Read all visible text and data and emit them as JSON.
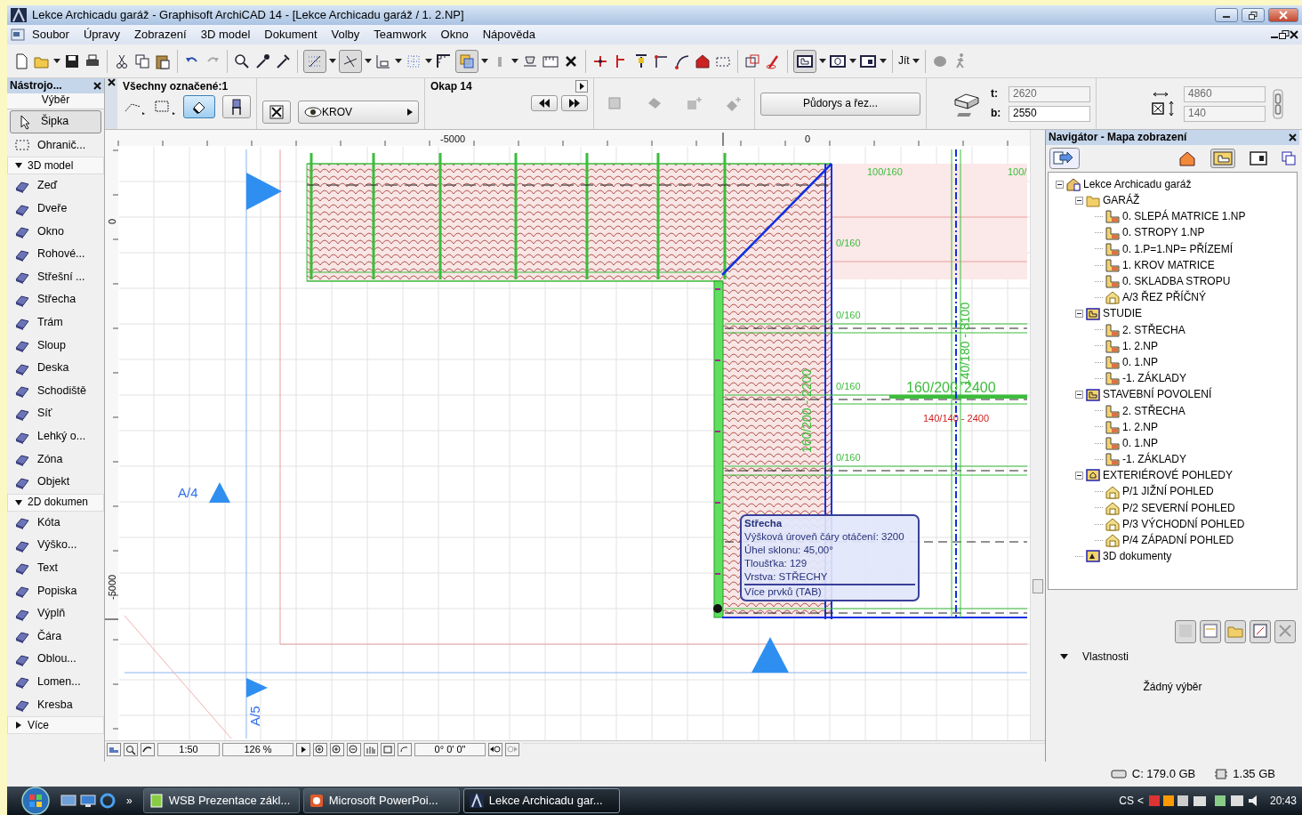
{
  "window": {
    "title": "Lekce Archicadu garáž - Graphisoft ArchiCAD 14 - [Lekce Archicadu garáž / 1. 2.NP]"
  },
  "menu": [
    "Soubor",
    "Úpravy",
    "Zobrazení",
    "3D model",
    "Dokument",
    "Volby",
    "Teamwork",
    "Okno",
    "Nápověda"
  ],
  "toolbar": {
    "go_label": "Jít"
  },
  "toolbox": {
    "title": "Nástrojo...",
    "selection": "Výběr",
    "items": [
      {
        "kind": "tool",
        "label": "Šipka",
        "selected": true
      },
      {
        "kind": "tool",
        "label": "Ohranič...",
        "selected": false
      },
      {
        "kind": "group",
        "label": "3D model",
        "expanded": true
      },
      {
        "kind": "tool",
        "label": "Zeď",
        "selected": false
      },
      {
        "kind": "tool",
        "label": "Dveře",
        "selected": false
      },
      {
        "kind": "tool",
        "label": "Okno",
        "selected": false
      },
      {
        "kind": "tool",
        "label": "Rohové...",
        "selected": false
      },
      {
        "kind": "tool",
        "label": "Střešní ...",
        "selected": false
      },
      {
        "kind": "tool",
        "label": "Střecha",
        "selected": false
      },
      {
        "kind": "tool",
        "label": "Trám",
        "selected": false
      },
      {
        "kind": "tool",
        "label": "Sloup",
        "selected": false
      },
      {
        "kind": "tool",
        "label": "Deska",
        "selected": false
      },
      {
        "kind": "tool",
        "label": "Schodiště",
        "selected": false
      },
      {
        "kind": "tool",
        "label": "Síť",
        "selected": false
      },
      {
        "kind": "tool",
        "label": "Lehký o...",
        "selected": false
      },
      {
        "kind": "tool",
        "label": "Zóna",
        "selected": false
      },
      {
        "kind": "tool",
        "label": "Objekt",
        "selected": false
      },
      {
        "kind": "group",
        "label": "2D dokumen",
        "expanded": true
      },
      {
        "kind": "tool",
        "label": "Kóta",
        "selected": false
      },
      {
        "kind": "tool",
        "label": "Výško...",
        "selected": false
      },
      {
        "kind": "tool",
        "label": "Text",
        "selected": false
      },
      {
        "kind": "tool",
        "label": "Popiska",
        "selected": false
      },
      {
        "kind": "tool",
        "label": "Výplň",
        "selected": false
      },
      {
        "kind": "tool",
        "label": "Čára",
        "selected": false
      },
      {
        "kind": "tool",
        "label": "Oblou...",
        "selected": false
      },
      {
        "kind": "tool",
        "label": "Lomen...",
        "selected": false
      },
      {
        "kind": "tool",
        "label": "Kresba",
        "selected": false
      },
      {
        "kind": "group",
        "label": "Více",
        "expanded": false
      }
    ]
  },
  "info_box": {
    "selection": "Všechny označené:1",
    "layer": "KROV",
    "story": "Okap 14",
    "view_button": "Půdorys a řez...",
    "fields": [
      {
        "label": "t:",
        "value": "2620",
        "disabled": true
      },
      {
        "label": "b:",
        "value": "2550",
        "disabled": false
      }
    ],
    "size_fields": [
      {
        "value": "4860",
        "disabled": true
      },
      {
        "value": "140",
        "disabled": true
      }
    ]
  },
  "canvas": {
    "top_ruler": [
      "-5000",
      "0"
    ],
    "left_ruler": [
      "0",
      "-5000"
    ],
    "labels": [
      {
        "kind": "dim",
        "text": "100/160"
      },
      {
        "kind": "dim",
        "text": "100/"
      },
      {
        "kind": "dim",
        "text": "0/160"
      },
      {
        "kind": "dim",
        "text": "0/160"
      },
      {
        "kind": "dim",
        "text": "0/160"
      },
      {
        "kind": "dim",
        "text": "0/160"
      },
      {
        "kind": "dim_big",
        "text": "160/200"
      },
      {
        "kind": "dim_big",
        "text": "2400"
      },
      {
        "kind": "red",
        "text": "140/140 - 2400"
      },
      {
        "kind": "axis",
        "text": "A/4"
      },
      {
        "kind": "axis_vertical",
        "text": "A/5"
      },
      {
        "kind": "dim_vertical",
        "text": "140/180 - 8100"
      },
      {
        "kind": "dim_vertical",
        "text": "160/200 - 2200"
      }
    ],
    "tooltip": {
      "title": "Střecha",
      "lines": [
        "Výšková úroveň čáry otáčení: 3200",
        "Úhel sklonu: 45,00°",
        "Tloušťka: 129",
        "Vrstva: STŘECHY"
      ],
      "footer": "Více prvků (TAB)"
    },
    "controls": {
      "scale": "1:50",
      "zoom": "126 %",
      "angle": "0° 0' 0\""
    }
  },
  "navigator": {
    "title": "Navigátor - Mapa zobrazení",
    "tree": [
      {
        "kind": "project",
        "label": "Lekce Archicadu garáž",
        "expanded": true,
        "children": [
          {
            "kind": "folder",
            "label": "GARÁŽ",
            "expanded": true,
            "children": [
              {
                "kind": "floor",
                "label": "0. SLEPÁ MATRICE 1.NP"
              },
              {
                "kind": "floor",
                "label": "0. STROPY 1.NP"
              },
              {
                "kind": "floor",
                "label": "0.  1.P=1.NP= PŘÍZEMÍ"
              },
              {
                "kind": "floor",
                "label": "1. KROV MATRICE"
              },
              {
                "kind": "floor",
                "label": "0. SKLADBA STROPU"
              },
              {
                "kind": "view",
                "label": "A/3 ŘEZ  PŘÍČNÝ"
              }
            ]
          },
          {
            "kind": "set",
            "label": "STUDIE",
            "expanded": true,
            "children": [
              {
                "kind": "floor",
                "label": "2. STŘECHA"
              },
              {
                "kind": "floor",
                "label": "1. 2.NP"
              },
              {
                "kind": "floor",
                "label": "0. 1.NP"
              },
              {
                "kind": "floor",
                "label": "-1. ZÁKLADY"
              }
            ]
          },
          {
            "kind": "set",
            "label": "STAVEBNÍ POVOLENÍ",
            "expanded": true,
            "children": [
              {
                "kind": "floor",
                "label": "2. STŘECHA"
              },
              {
                "kind": "floor",
                "label": "1. 2.NP"
              },
              {
                "kind": "floor",
                "label": "0. 1.NP"
              },
              {
                "kind": "floor",
                "label": "-1. ZÁKLADY"
              }
            ]
          },
          {
            "kind": "elevations",
            "label": "EXTERIÉROVÉ POHLEDY",
            "expanded": true,
            "children": [
              {
                "kind": "view",
                "label": "P/1 JIŽNÍ POHLED"
              },
              {
                "kind": "view",
                "label": "P/2 SEVERNÍ POHLED"
              },
              {
                "kind": "view",
                "label": "P/3 VÝCHODNÍ POHLED"
              },
              {
                "kind": "view",
                "label": "P/4 ZÁPADNÍ POHLED"
              }
            ]
          },
          {
            "kind": "documents",
            "label": "3D dokumenty"
          }
        ]
      }
    ],
    "properties_label": "Vlastnosti",
    "properties_expanded": true,
    "empty_text": "Žádný výběr"
  },
  "status": {
    "disk": "C: 179.0 GB",
    "memory": "1.35 GB"
  },
  "taskbar": {
    "more": "»",
    "tasks": [
      {
        "label": "WSB Prezentace zákl...",
        "selected": false
      },
      {
        "label": "Microsoft PowerPoi...",
        "selected": false
      },
      {
        "label": "Lekce Archicadu gar...",
        "selected": true
      }
    ],
    "language": "CS",
    "tray_arrow": "<",
    "clock": "20:43"
  }
}
